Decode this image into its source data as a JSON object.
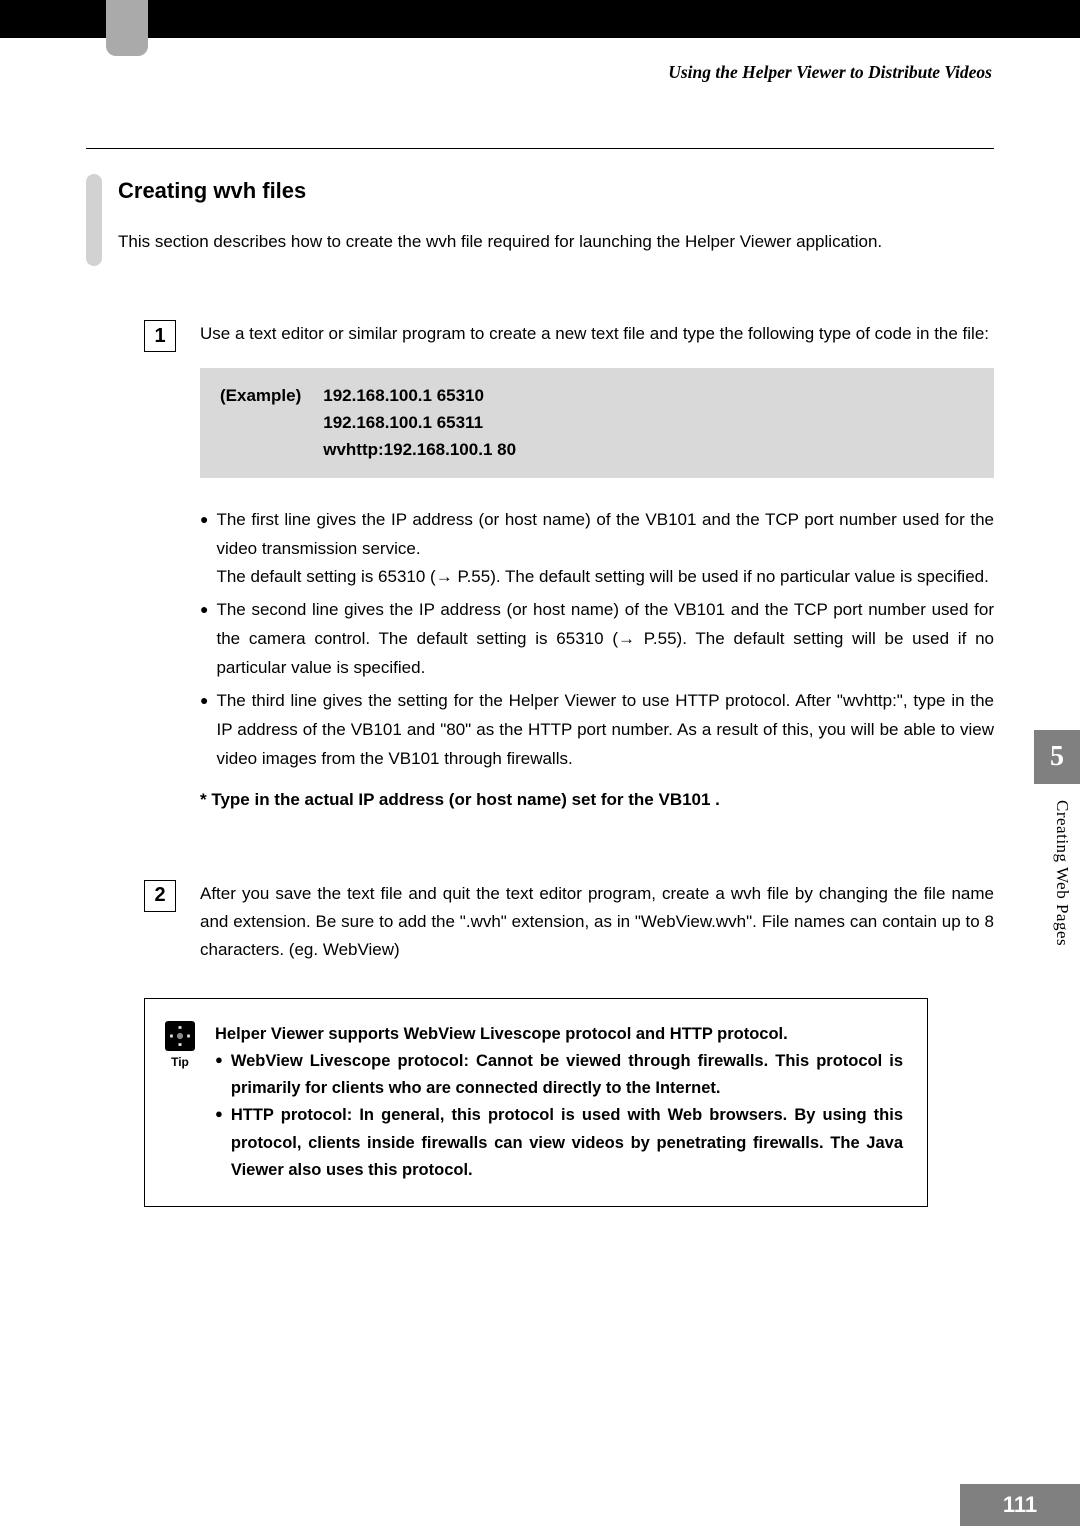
{
  "breadcrumb": "Using the Helper Viewer to Distribute Videos",
  "heading": "Creating wvh files",
  "intro": "This section describes how to create the wvh file required for launching the Helper Viewer application.",
  "steps": {
    "s1": {
      "num": "1",
      "lead": "Use a text editor or similar program to create a new text file and type the following type of code in the file:",
      "example_label": "(Example)",
      "example_lines": "192.168.100.1 65310\n192.168.100.1 65311\nwvhttp:192.168.100.1 80",
      "b1": "The first line gives the IP address (or host name) of the VB101 and the TCP port number used for the video transmission service.\nThe default setting is 65310 (→ P.55). The default setting will be used if no particular value is specified.",
      "b2": "The second line gives the IP address (or host name) of the VB101 and the TCP port number used for the camera control. The default setting is 65310 (→ P.55). The default setting will be used if no particular value is specified.",
      "b3": "The third line gives the setting for the Helper Viewer to use HTTP protocol. After \"wvhttp:\", type in the IP address of the VB101 and \"80\" as the HTTP port number. As a result of this, you will be able to view video images from the VB101 through firewalls.",
      "note": "* Type in the actual IP address (or host name) set for the VB101 ."
    },
    "s2": {
      "num": "2",
      "lead": "After you save the text file and quit the text editor program, create a wvh file by changing the file name and extension. Be sure to add the \".wvh\" extension, as in \"WebView.wvh\". File names can contain up to 8 characters. (eg. WebView)"
    }
  },
  "tip": {
    "label": "Tip",
    "intro": "Helper Viewer supports WebView Livescope protocol and HTTP protocol.",
    "b1": "WebView Livescope protocol: Cannot be viewed through firewalls. This protocol is primarily for clients who are connected directly to the Internet.",
    "b2": "HTTP protocol: In general, this protocol is used with Web browsers. By using this protocol, clients inside firewalls can view videos by penetrating firewalls. The Java Viewer also uses this protocol."
  },
  "side": {
    "chapter": "5",
    "label": "Creating Web Pages"
  },
  "page_number": "111"
}
